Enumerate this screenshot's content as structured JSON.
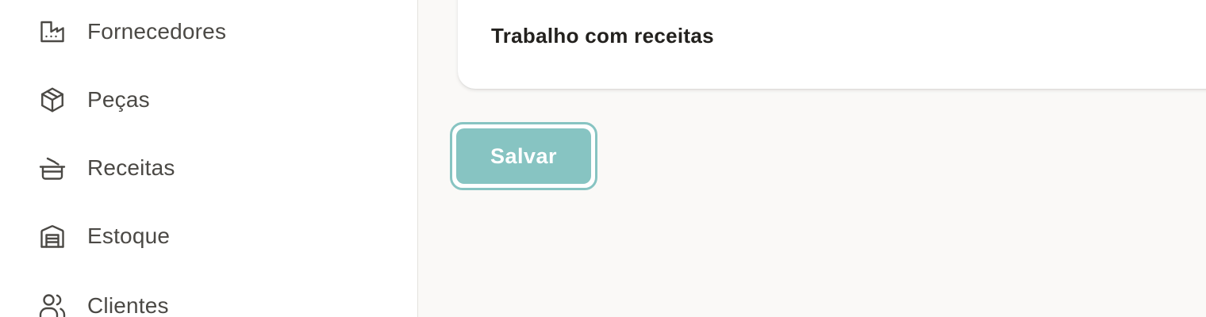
{
  "sidebar": {
    "items": [
      {
        "label": "Fornecedores",
        "icon": "factory-icon"
      },
      {
        "label": "Peças",
        "icon": "package-icon"
      },
      {
        "label": "Receitas",
        "icon": "cooking-pot-icon"
      },
      {
        "label": "Estoque",
        "icon": "warehouse-icon"
      },
      {
        "label": "Clientes",
        "icon": "users-icon"
      }
    ]
  },
  "main": {
    "card": {
      "option_label": "Trabalho com receitas"
    },
    "save_label": "Salvar"
  },
  "colors": {
    "accent": "#87c4c2",
    "text_primary": "#23211e",
    "sidebar_text": "#4b4945",
    "background": "#faf9f7"
  }
}
